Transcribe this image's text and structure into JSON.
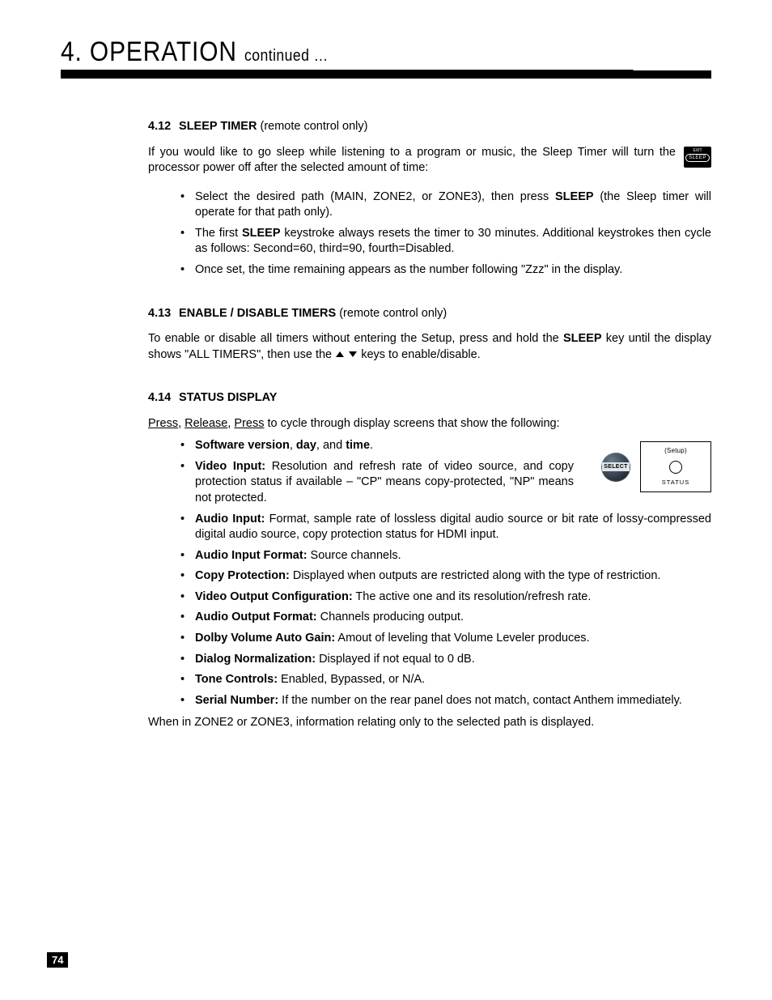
{
  "chapter": {
    "number": "4.",
    "title": "OPERATION",
    "continued": "continued …"
  },
  "page_number": "74",
  "sleep_badge": {
    "top": "EXIT",
    "pill": "SLEEP"
  },
  "status_panel": {
    "select": "SELECT",
    "setup": "(Setup)",
    "status": "STATUS"
  },
  "s412": {
    "num": "4.12",
    "title": "SLEEP TIMER",
    "paren": "(remote control only)",
    "intro": "If you would like to go sleep while listening to a program or music, the Sleep Timer will turn the processor power off after the selected amount of time:",
    "b1_a": "Select the desired path (MAIN, ZONE2, or ZONE3), then press ",
    "b1_bold": "SLEEP",
    "b1_b": " (the Sleep timer will operate for that path only).",
    "b2_a": "The first ",
    "b2_bold": "SLEEP",
    "b2_b": " keystroke always resets the timer to 30 minutes. Additional keystrokes then cycle as follows: Second=60, third=90, fourth=Disabled.",
    "b3": "Once set, the time remaining appears as the number following \"Zzz\" in the display."
  },
  "s413": {
    "num": "4.13",
    "title": "ENABLE / DISABLE TIMERS",
    "paren": "(remote control only)",
    "p_a": "To enable or disable all timers without entering the Setup, press and hold the ",
    "p_bold": "SLEEP",
    "p_b": " key until the display shows \"ALL TIMERS\", then use the ",
    "p_c": " keys to enable/disable."
  },
  "s414": {
    "num": "4.14",
    "title": "STATUS DISPLAY",
    "intro_u1": "Press",
    "intro_c1": ", ",
    "intro_u2": "Release",
    "intro_c2": ", ",
    "intro_u3": "Press",
    "intro_rest": " to cycle through display screens that show the following:",
    "b1_a": "Software version",
    "b1_b": ", ",
    "b1_c": "day",
    "b1_d": ", and ",
    "b1_e": "time",
    "b1_f": ".",
    "b2_bold": "Video Input:",
    "b2_rest": " Resolution and refresh rate of video source, and copy protection status if available – \"CP\" means copy-protected, \"NP\" means not protected.",
    "b3_bold": "Audio Input:",
    "b3_rest": "  Format, sample rate of lossless digital audio source or bit rate of lossy-compressed digital audio source, copy protection status for HDMI input.",
    "b4_bold": "Audio Input Format:",
    "b4_rest": "  Source channels.",
    "b5_bold": "Copy Protection:",
    "b5_rest": "  Displayed when outputs are restricted along with the type of restriction.",
    "b6_bold": "Video Output Configuration:",
    "b6_rest": "  The active one and its resolution/refresh rate.",
    "b7_bold": "Audio Output Format:",
    "b7_rest": "  Channels producing output.",
    "b8_bold": "Dolby Volume Auto Gain:",
    "b8_rest": "  Amout of leveling that Volume Leveler produces.",
    "b9_bold": "Dialog Normalization:",
    "b9_rest": "  Displayed if not equal to 0 dB.",
    "b10_bold": "Tone Controls:",
    "b10_rest": "  Enabled, Bypassed, or N/A.",
    "b11_bold": "Serial Number:",
    "b11_rest": "  If the number on the rear panel does not match, contact Anthem immediately.",
    "footer": "When in ZONE2 or ZONE3, information relating only to the selected path is displayed."
  }
}
